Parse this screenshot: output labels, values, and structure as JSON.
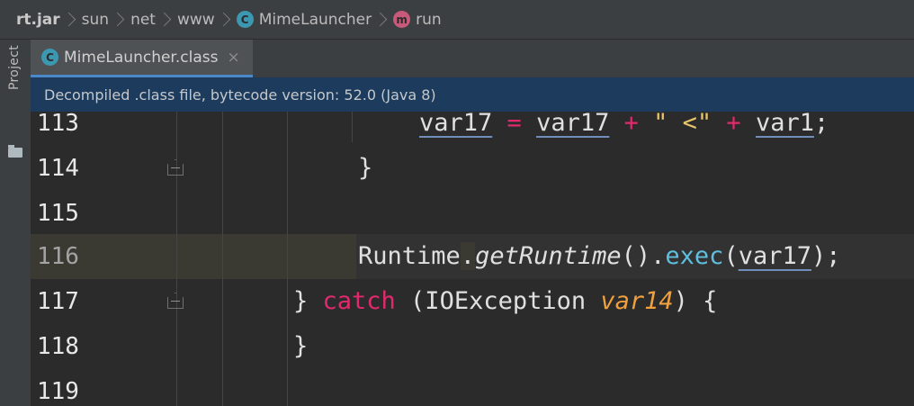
{
  "breadcrumb": {
    "items": [
      {
        "label": "rt.jar",
        "icon": ""
      },
      {
        "label": "sun",
        "icon": ""
      },
      {
        "label": "net",
        "icon": ""
      },
      {
        "label": "www",
        "icon": ""
      },
      {
        "label": "MimeLauncher",
        "icon": "class-icon",
        "badge": "C"
      },
      {
        "label": "run",
        "icon": "method-icon",
        "badge": "m"
      }
    ]
  },
  "sidebar": {
    "project_label": "Project"
  },
  "tab": {
    "label": "MimeLauncher.class",
    "badge": "C",
    "close": "×"
  },
  "banner": {
    "text": "Decompiled .class file, bytecode version: 52.0 (Java 8)"
  },
  "editor": {
    "current_line": 116,
    "lines": [
      {
        "number": "113",
        "t1": "var17",
        "t2": " = ",
        "t3": "var17",
        "t4": " + ",
        "t5": "\" <\"",
        "t6": " + ",
        "t7": "var1",
        "t8": ";"
      },
      {
        "number": "114",
        "t1": "}"
      },
      {
        "number": "115"
      },
      {
        "number": "116",
        "t1": "Runtime",
        "t2": ".",
        "t3": "getRuntime",
        "t4": "().",
        "t5": "exec",
        "t6": "(",
        "t7": "var17",
        "t8": ");"
      },
      {
        "number": "117",
        "t1": "} ",
        "t2": "catch",
        "t3": " (IOException ",
        "t4": "var14",
        "t5": ") {"
      },
      {
        "number": "118",
        "t1": "}"
      },
      {
        "number": "119"
      }
    ]
  },
  "colors": {
    "keyword": "#e3296d",
    "string": "#e8c46a",
    "method": "#5fbfdf",
    "parameter": "#f0a03c",
    "banner_bg": "#1d3b5c",
    "tab_underline": "#4a88c7"
  }
}
